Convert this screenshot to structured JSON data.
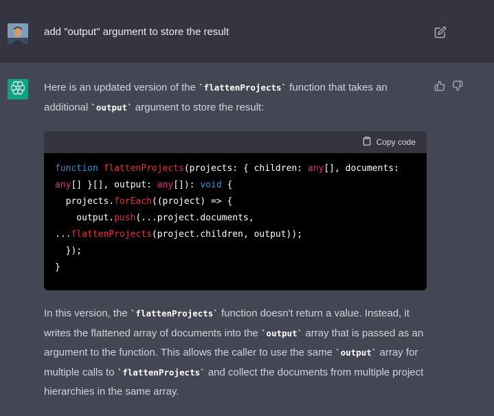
{
  "user_message": {
    "text": "add \"output\" argument to store the result"
  },
  "assistant": {
    "intro": {
      "part1": "Here is an updated version of the ",
      "code1": "`flattenProjects`",
      "part2": " function that takes an additional ",
      "code2": "`output`",
      "part3": " argument to store the result:"
    },
    "code": {
      "copy_label": "Copy code",
      "lines": [
        {
          "kw": "function",
          "sp": " ",
          "fn": "flattenProjects",
          "a": "(projects: { children: ",
          "t1": "any",
          "b": "[], documents:"
        },
        {
          "t1": "any",
          "a": "[] }[], output: ",
          "t2": "any",
          "b": "[]): ",
          "t3": "void",
          "c": " {"
        },
        {
          "a": "  projects.",
          "fn": "forEach",
          "b": "((project) => {"
        },
        {
          "a": "    output.",
          "fn": "push",
          "b": "(...project.documents,"
        },
        {
          "a": "...",
          "fn": "flattenProjects",
          "b": "(project.children, output));"
        },
        {
          "a": "  });"
        },
        {
          "a": "}"
        }
      ]
    },
    "explanation": {
      "part1": "In this version, the ",
      "code1": "`flattenProjects`",
      "part2": " function doesn't return a value. Instead, it writes the flattened array of documents into the ",
      "code2": "`output`",
      "part3": " array that is passed as an argument to the function. This allows the caller to use the same ",
      "code3": "`output`",
      "part4": " array for multiple calls to ",
      "code4": "`flattenProjects`",
      "part5": " and collect the documents from multiple project hierarchies in the same array."
    }
  },
  "icons": {
    "user": "user-avatar",
    "assistant": "openai-logo-icon",
    "edit": "edit-icon",
    "like": "thumbs-up-icon",
    "dislike": "thumbs-down-icon",
    "copy": "clipboard-icon"
  },
  "colors": {
    "background": "#444654",
    "user_row": "#343541",
    "assistant_logo": "#10a37f",
    "code_bg": "#000000",
    "keyword": "#2e95d3",
    "function": "#f22c3d",
    "type": "#df3079"
  }
}
